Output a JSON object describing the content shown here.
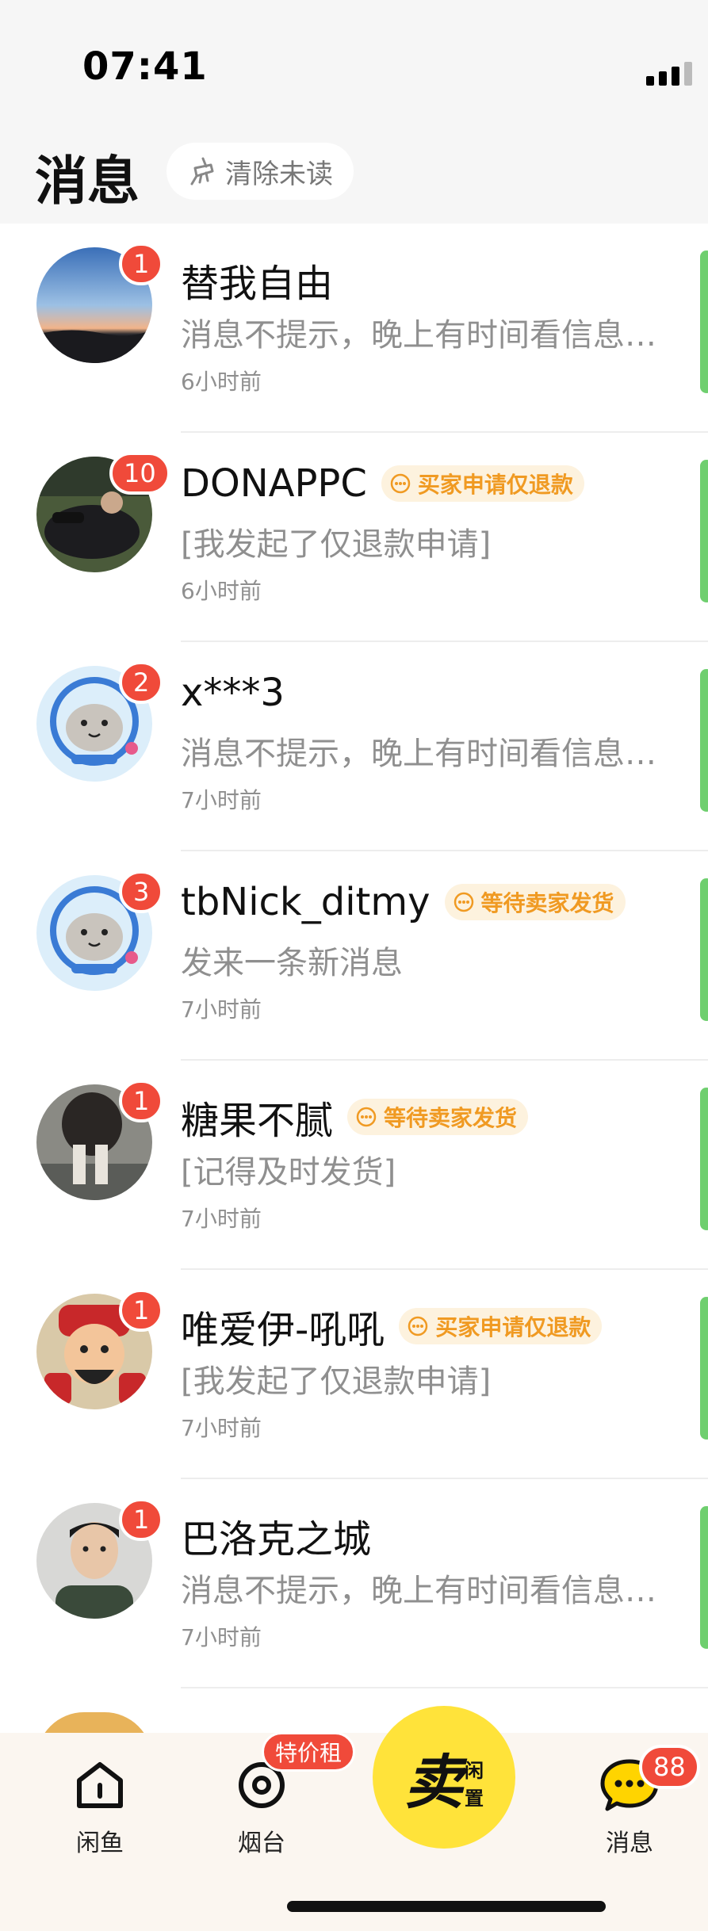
{
  "status_bar": {
    "time": "07:41"
  },
  "header": {
    "title": "消息",
    "clear_label": "清除未读"
  },
  "conversations": [
    {
      "name": "替我自由",
      "badge": "1",
      "tag": "",
      "preview": "消息不提示，晚上有时间看信息…",
      "time": "6小时前",
      "avatar": "sunset"
    },
    {
      "name": "DONAPPC",
      "badge": "10",
      "tag": "买家申请仅退款",
      "preview": "[我发起了仅退款申请]",
      "time": "6小时前",
      "avatar": "photo-dark"
    },
    {
      "name": "x***3",
      "badge": "2",
      "tag": "",
      "preview": "消息不提示，晚上有时间看信息…",
      "time": "7小时前",
      "avatar": "seal-default"
    },
    {
      "name": "tbNick_ditmy",
      "badge": "3",
      "tag": "等待卖家发货",
      "preview": "发来一条新消息",
      "time": "7小时前",
      "avatar": "seal-default"
    },
    {
      "name": "糖果不腻",
      "badge": "1",
      "tag": "等待卖家发货",
      "preview": "[记得及时发货]",
      "time": "7小时前",
      "avatar": "photo-legs"
    },
    {
      "name": "唯爱伊-吼吼",
      "badge": "1",
      "tag": "买家申请仅退款",
      "preview": "[我发起了仅退款申请]",
      "time": "7小时前",
      "avatar": "caishen"
    },
    {
      "name": "巴洛克之城",
      "badge": "1",
      "tag": "",
      "preview": "消息不提示，晚上有时间看信息…",
      "time": "7小时前",
      "avatar": "portrait"
    }
  ],
  "tabbar": {
    "home_label": "闲鱼",
    "yantai_label": "烟台",
    "promo_label": "特价租",
    "sell_main": "卖",
    "sell_sub_1": "闲",
    "sell_sub_2": "置",
    "messages_label": "消息",
    "messages_badge": "88"
  },
  "colors": {
    "badge": "#f04a3a",
    "tag_text": "#f09a22",
    "tag_bg": "#fdf2de",
    "sell_button": "#ffe33a"
  }
}
